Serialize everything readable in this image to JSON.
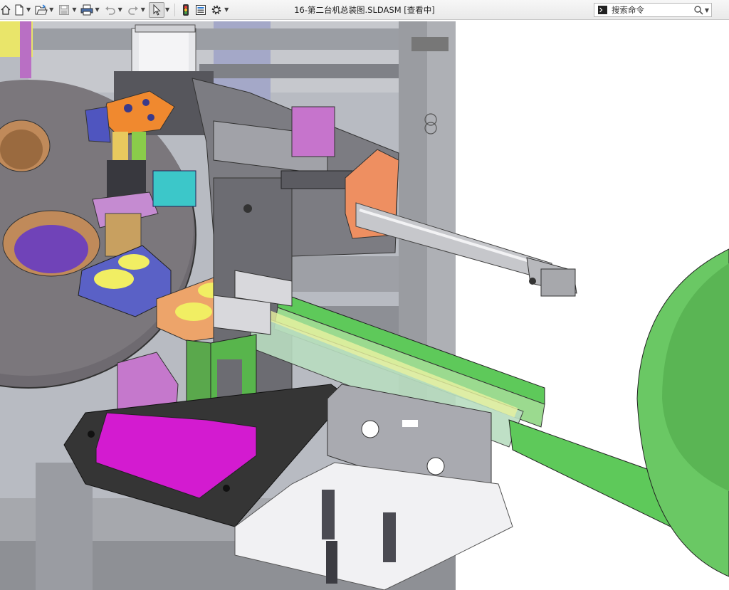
{
  "window": {
    "title": "16-第二台机总装图.SLDASM [查看中]"
  },
  "toolbar": {
    "items": [
      {
        "name": "home-icon"
      },
      {
        "name": "new-document-icon"
      },
      {
        "name": "open-folder-icon"
      },
      {
        "name": "save-icon"
      },
      {
        "name": "print-icon"
      },
      {
        "name": "undo-icon"
      },
      {
        "name": "redo-icon"
      },
      {
        "name": "select-pointer-icon"
      },
      {
        "name": "traffic-light-icon"
      },
      {
        "name": "file-properties-icon"
      },
      {
        "name": "gear-icon"
      }
    ]
  },
  "search": {
    "placeholder": "搜索命令"
  },
  "viewport": {
    "colors": {
      "background": "#ffffff",
      "frame": "#8f9196",
      "gray_part": "#7a7a80",
      "orange_part": "#f08a3a",
      "purple_part": "#c276c8",
      "blue_part": "#5a61c6",
      "magenta_part": "#d31bd0",
      "green_part": "#5ec95a",
      "yellow_part": "#f1ee63",
      "teal_part": "#3cc7c9",
      "salmon_part": "#ee8f61"
    }
  }
}
